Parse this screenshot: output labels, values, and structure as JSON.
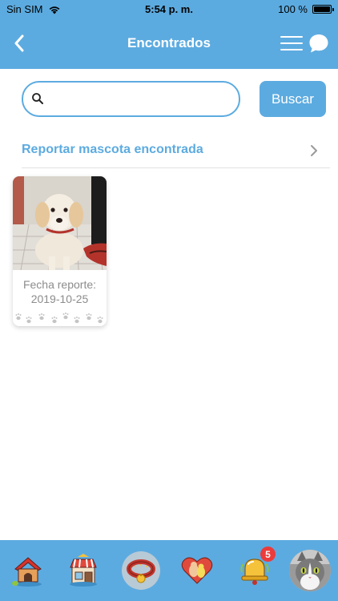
{
  "status_bar": {
    "carrier": "Sin SIM",
    "time": "5:54 p. m.",
    "battery_text": "100 %",
    "battery_level": 1.0
  },
  "nav": {
    "title": "Encontrados",
    "back_icon": "chevron-left-icon",
    "menu_icon": "hamburger-menu-icon",
    "chat_icon": "chat-bubble-icon"
  },
  "search": {
    "value": "",
    "placeholder": "",
    "button_label": "Buscar"
  },
  "report": {
    "label": "Reportar mascota encontrada"
  },
  "pets": [
    {
      "date_label": "Fecha reporte:",
      "date_value": "2019-10-25"
    }
  ],
  "tabs": [
    {
      "icon": "doghouse-icon",
      "active": false
    },
    {
      "icon": "pet-shop-icon",
      "active": false
    },
    {
      "icon": "pet-collar-icon",
      "active": true
    },
    {
      "icon": "adoption-heart-icon",
      "active": false
    },
    {
      "icon": "notification-bell-icon",
      "active": false,
      "badge": "5"
    },
    {
      "icon": "profile-avatar",
      "active": false
    }
  ],
  "colors": {
    "primary": "#5cabe0",
    "badge": "#ec3b3b",
    "muted_text": "#8c8c8c"
  }
}
